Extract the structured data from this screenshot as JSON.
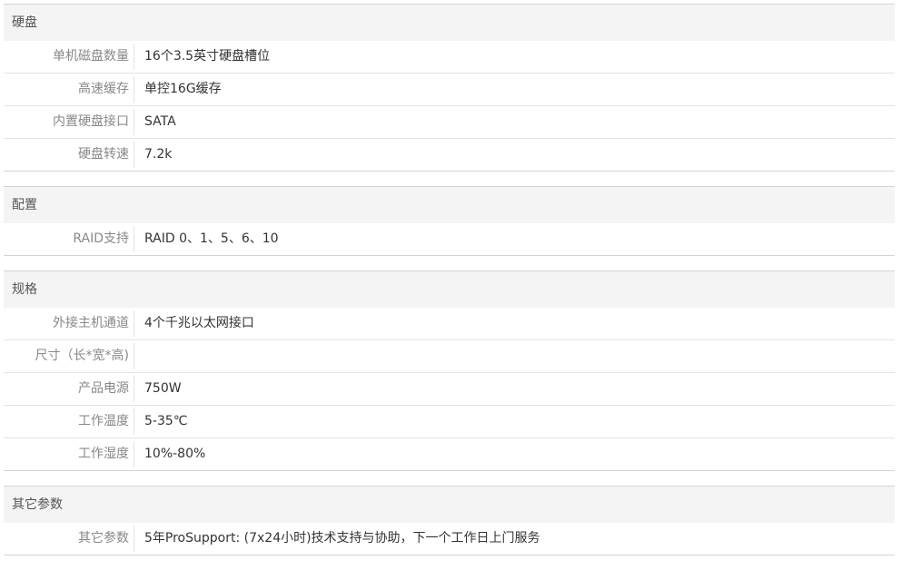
{
  "sections": [
    {
      "title": "硬盘",
      "rows": [
        {
          "label": "单机磁盘数量",
          "value": "16个3.5英寸硬盘槽位"
        },
        {
          "label": "高速缓存",
          "value": "单控16G缓存"
        },
        {
          "label": "内置硬盘接口",
          "value": "SATA"
        },
        {
          "label": "硬盘转速",
          "value": "7.2k"
        }
      ]
    },
    {
      "title": "配置",
      "rows": [
        {
          "label": "RAID支持",
          "value": "RAID 0、1、5、6、10"
        }
      ]
    },
    {
      "title": "规格",
      "rows": [
        {
          "label": "外接主机通道",
          "value": "4个千兆以太网接口"
        },
        {
          "label": "尺寸（长*宽*高)",
          "value": ""
        },
        {
          "label": "产品电源",
          "value": "750W"
        },
        {
          "label": "工作温度",
          "value": "5-35℃"
        },
        {
          "label": "工作湿度",
          "value": "10%-80%"
        }
      ]
    },
    {
      "title": "其它参数",
      "rows": [
        {
          "label": "其它参数",
          "value": "5年ProSupport: (7x24小时)技术支持与协助，下一个工作日上门服务"
        }
      ]
    }
  ]
}
